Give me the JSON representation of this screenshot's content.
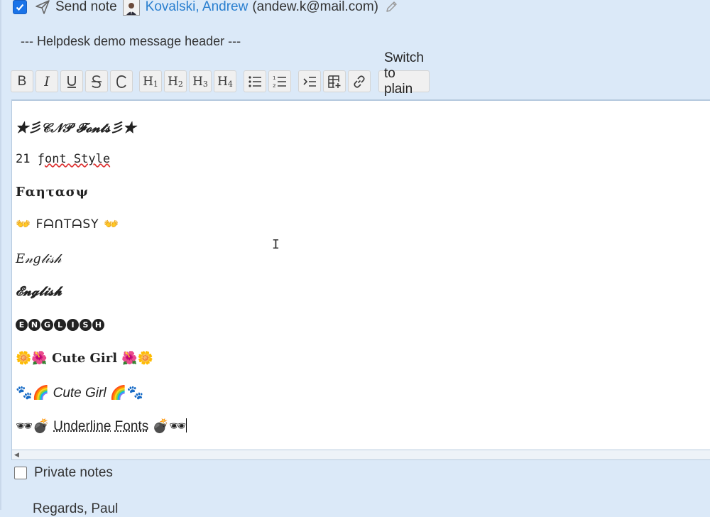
{
  "top_row": {
    "send_note_checked": true,
    "send_note_label": "Send note",
    "recipient_name": "Kovalski, Andrew",
    "recipient_email": "(andew.k@mail.com)"
  },
  "header_text": "--- Helpdesk demo message header ---",
  "toolbar": {
    "bold": "B",
    "italic": "I",
    "h1": "H",
    "h2": "H",
    "h3": "H",
    "h4": "H",
    "h1_num": "1",
    "h2_num": "2",
    "h3_num": "3",
    "h4_num": "4",
    "switch_plain": "Switch to plain text"
  },
  "editor": {
    "lines": [
      "★彡𝒞𝒩𝒫 𝓕𝓸𝓷𝓽𝓼彡★",
      "21 ƒ",
      "Fαητασψ",
      "👐 FᗩᑎTᗩSY 👐",
      "𝐸𝓃𝑔𝓁𝒾𝓈𝒽",
      "𝓔𝓷𝓰𝓵𝓲𝓼𝓱",
      "ENGLISH",
      "🌼🌺 Cute Girl 🌺🌼",
      "🐾🌈 Cute Girl 🌈🐾",
      "🕶💣 Underline Fonts 💣🕶"
    ],
    "l2_rest": "ont Style",
    "l8_prefix": "🌼🌺",
    "l8_text": " Cute Girl ",
    "l8_suffix": "🌺🌼",
    "l9_prefix": "🐾🌈",
    "l9_text": " Cute Girl ",
    "l9_suffix": "🌈🐾",
    "l10_prefix": "🕶💣",
    "l10_u1": "Underline",
    "l10_u2": "Fonts",
    "l10_suffix": "💣🕶"
  },
  "private_notes": {
    "checked": false,
    "label": "Private notes"
  },
  "signature_line": "Regards, Paul",
  "colors": {
    "background": "#dbe9f8",
    "link": "#2a7fcf",
    "checkbox": "#1a73e8"
  },
  "icons": [
    "checkbox-checked-icon",
    "send-icon",
    "avatar",
    "pencil-icon",
    "bullet-list-icon",
    "numbered-list-icon",
    "indent-icon",
    "table-icon",
    "link-icon",
    "text-cursor-icon"
  ]
}
